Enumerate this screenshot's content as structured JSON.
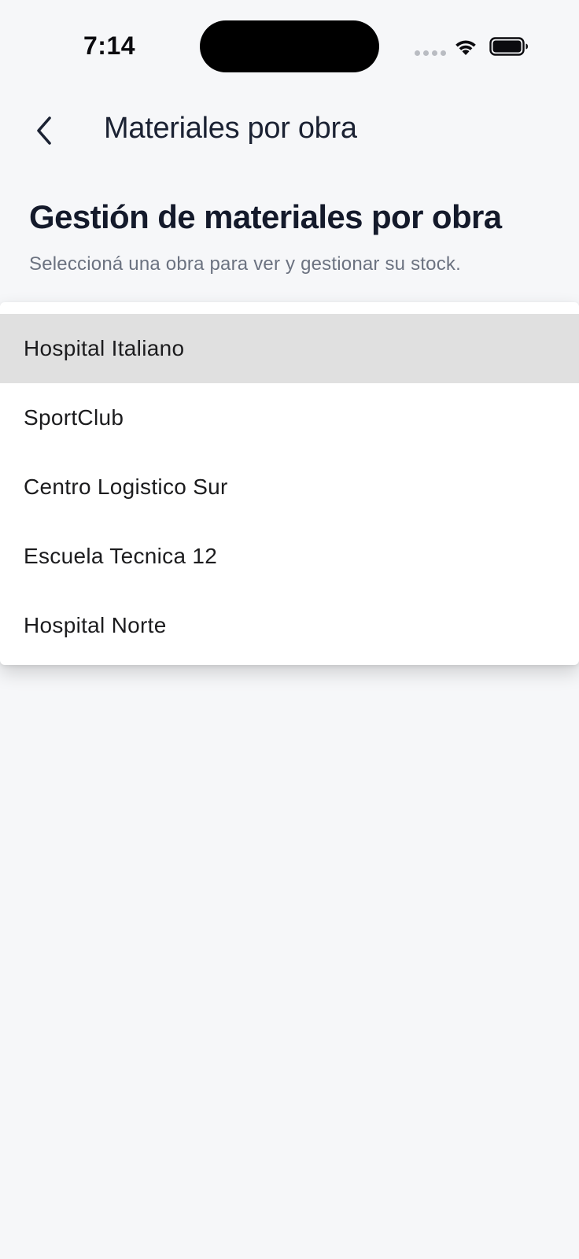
{
  "status_bar": {
    "time": "7:14",
    "wifi_icon": "wifi-icon",
    "battery_icon": "battery-full-icon"
  },
  "nav": {
    "back_icon": "chevron-left-icon",
    "title": "Materiales por obra"
  },
  "header": {
    "heading": "Gestión de materiales por obra",
    "subtitle": "Seleccioná una obra para ver y gestionar su stock."
  },
  "dropdown": {
    "selected_index": 0,
    "items": [
      {
        "label": "Hospital Italiano"
      },
      {
        "label": "SportClub"
      },
      {
        "label": "Centro Logistico Sur"
      },
      {
        "label": "Escuela Tecnica 12"
      },
      {
        "label": "Hospital Norte"
      }
    ]
  },
  "colors": {
    "background": "#f6f7f9",
    "text_primary": "#141a2b",
    "text_secondary": "#6b7280",
    "selected_item_bg": "#e0e0e0"
  }
}
